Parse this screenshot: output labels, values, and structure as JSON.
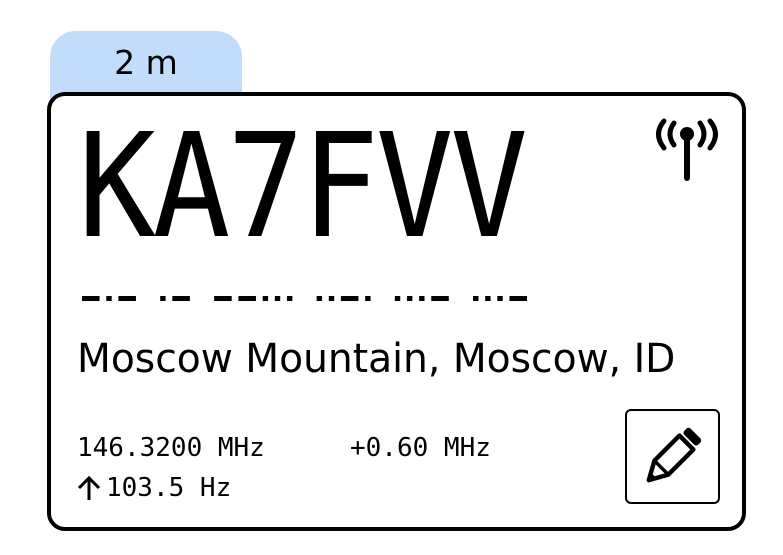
{
  "band": {
    "label": "2 m",
    "tab_color": "#c2dcfb"
  },
  "repeater": {
    "callsign": "KA7FVV",
    "morse": "-.- .- --... ..-. ...- ...-",
    "location": "Moscow Mountain, Moscow, ID",
    "frequency": "146.3200 MHz",
    "offset": "+0.60 MHz",
    "tone": "103.5 Hz"
  },
  "icons": {
    "antenna": "antenna-broadcast-icon",
    "tone_arrow": "arrow-up-icon",
    "edit": "pencil-icon"
  }
}
